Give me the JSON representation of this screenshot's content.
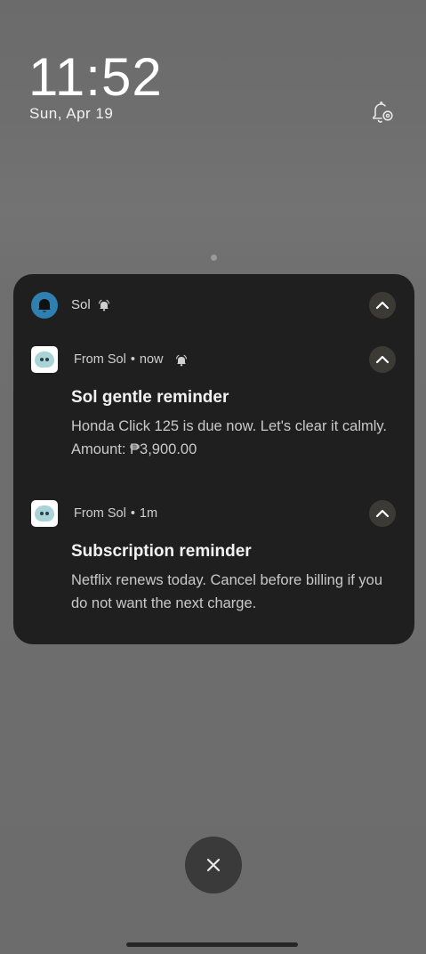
{
  "lockscreen": {
    "time": "11:52",
    "date": "Sun, Apr 19"
  },
  "group": {
    "app_name": "Sol"
  },
  "notifications": [
    {
      "source": "From Sol",
      "separator": "•",
      "time": "now",
      "title": "Sol gentle reminder",
      "body": "Honda Click 125 is due now. Let's clear it calmly. Amount: ₱3,900.00"
    },
    {
      "source": "From Sol",
      "separator": "•",
      "time": "1m",
      "title": "Subscription reminder",
      "body": "Netflix renews today. Cancel before billing if you do not want the next charge."
    }
  ],
  "icons": {
    "notification_settings": "bell-gear-icon",
    "group_app": "bell-icon",
    "alerting": "alerting-bell-icon",
    "expand": "chevron-up-icon",
    "clear_all": "close-icon",
    "app": "sol-app-icon"
  },
  "colors": {
    "panel_bg": "#1f1f1f",
    "group_icon_bg": "#2f7fb0",
    "expand_bg": "#3b3a35",
    "app_icon_face": "#a9d3d6"
  }
}
